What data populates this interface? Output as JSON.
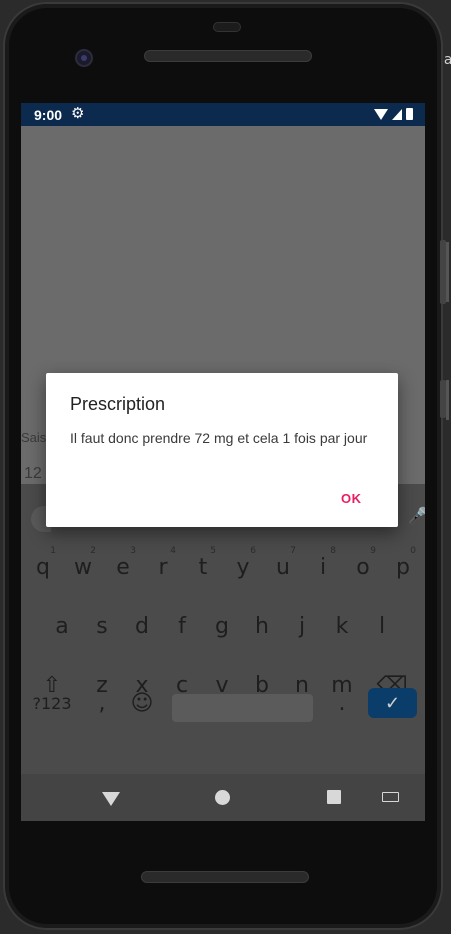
{
  "status_bar": {
    "time": "9:00",
    "settings_icon": "gear-icon",
    "wifi_icon": "wifi-icon",
    "signal_icon": "signal-icon",
    "battery_icon": "battery-icon"
  },
  "background": {
    "label": "Sais",
    "value": "12"
  },
  "dialog": {
    "title": "Prescription",
    "message": "Il faut donc prendre 72 mg et cela 1 fois par jour",
    "ok_label": "OK",
    "ok_color": "#e91e63"
  },
  "keyboard": {
    "row1": [
      {
        "key": "q",
        "hint": "1"
      },
      {
        "key": "w",
        "hint": "2"
      },
      {
        "key": "e",
        "hint": "3"
      },
      {
        "key": "r",
        "hint": "4"
      },
      {
        "key": "t",
        "hint": "5"
      },
      {
        "key": "y",
        "hint": "6"
      },
      {
        "key": "u",
        "hint": "7"
      },
      {
        "key": "i",
        "hint": "8"
      },
      {
        "key": "o",
        "hint": "9"
      },
      {
        "key": "p",
        "hint": "0"
      }
    ],
    "row2": [
      "a",
      "s",
      "d",
      "f",
      "g",
      "h",
      "j",
      "k",
      "l"
    ],
    "row3": [
      "z",
      "x",
      "c",
      "v",
      "b",
      "n",
      "m"
    ],
    "symbols_label": "?123",
    "comma_label": ",",
    "period_label": ".",
    "shift_icon": "shift-icon",
    "backspace_icon": "backspace-icon",
    "emoji_icon": "emoji-icon",
    "enter_icon": "check-icon",
    "mic_icon": "mic-icon",
    "accent_color": "#0b3d6a"
  },
  "nav_bar": {
    "back_icon": "back-icon",
    "home_icon": "home-icon",
    "recents_icon": "recents-icon",
    "keyboard_icon": "keyboard-switch-icon"
  }
}
